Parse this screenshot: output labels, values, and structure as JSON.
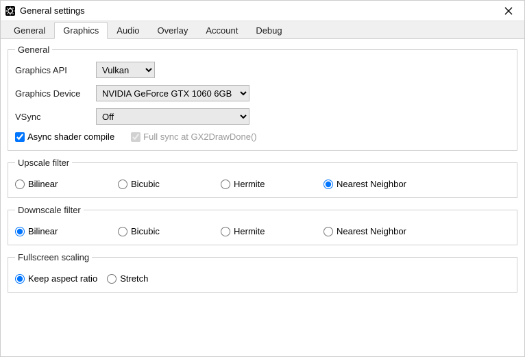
{
  "window": {
    "title": "General settings"
  },
  "tabs": [
    {
      "label": "General"
    },
    {
      "label": "Graphics"
    },
    {
      "label": "Audio"
    },
    {
      "label": "Overlay"
    },
    {
      "label": "Account"
    },
    {
      "label": "Debug"
    }
  ],
  "active_tab": "Graphics",
  "general_group": {
    "legend": "General",
    "api_label": "Graphics API",
    "api_value": "Vulkan",
    "device_label": "Graphics Device",
    "device_value": "NVIDIA GeForce GTX 1060 6GB",
    "vsync_label": "VSync",
    "vsync_value": "Off",
    "async_label": "Async shader compile",
    "async_checked": true,
    "fullsync_label": "Full sync at GX2DrawDone()",
    "fullsync_checked": true,
    "fullsync_disabled": true
  },
  "upscale": {
    "legend": "Upscale filter",
    "options": [
      {
        "label": "Bilinear"
      },
      {
        "label": "Bicubic"
      },
      {
        "label": "Hermite"
      },
      {
        "label": "Nearest Neighbor"
      }
    ],
    "selected": "Nearest Neighbor"
  },
  "downscale": {
    "legend": "Downscale filter",
    "options": [
      {
        "label": "Bilinear"
      },
      {
        "label": "Bicubic"
      },
      {
        "label": "Hermite"
      },
      {
        "label": "Nearest Neighbor"
      }
    ],
    "selected": "Bilinear"
  },
  "fullscreen": {
    "legend": "Fullscreen scaling",
    "options": [
      {
        "label": "Keep aspect ratio"
      },
      {
        "label": "Stretch"
      }
    ],
    "selected": "Keep aspect ratio"
  }
}
